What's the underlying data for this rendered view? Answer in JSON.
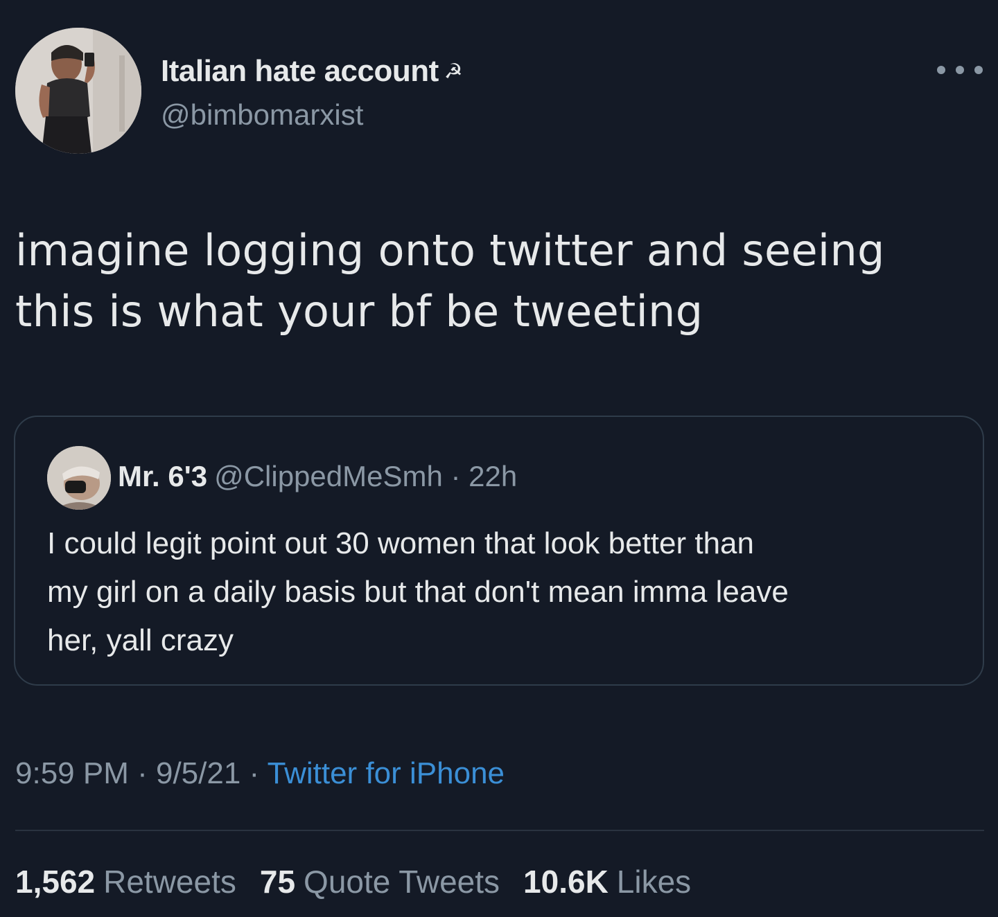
{
  "author": {
    "display_name": "Italian hate account",
    "name_emoji": "☭",
    "handle": "@bimbomarxist"
  },
  "tweet": {
    "text_line_1": "imagine logging onto twitter and seeing",
    "text_line_2": "this is what your bf be tweeting"
  },
  "quoted": {
    "display_name": "Mr. 6'3",
    "handle": "@ClippedMeSmh",
    "separator": " · ",
    "time": "22h",
    "text_line_1": "I could legit point out 30 women that look better than",
    "text_line_2": "my girl on a daily basis but that don't mean imma leave",
    "text_line_3": "her, yall crazy"
  },
  "meta": {
    "time": "9:59 PM",
    "sep1": " · ",
    "date": "9/5/21",
    "sep2": " · ",
    "source": "Twitter for iPhone"
  },
  "stats": {
    "retweets_count": "1,562",
    "retweets_label": "Retweets",
    "quotes_count": "75",
    "quotes_label": "Quote Tweets",
    "likes_count": "10.6K",
    "likes_label": "Likes"
  },
  "colors": {
    "background": "#141a26",
    "text_primary": "#e7e9ea",
    "text_secondary": "#8b98a5",
    "link": "#3b8fd6",
    "border": "#2f3c4a"
  },
  "icons": {
    "more": "more-horizontal-icon",
    "name_emoji": "hammer-and-sickle-icon"
  }
}
